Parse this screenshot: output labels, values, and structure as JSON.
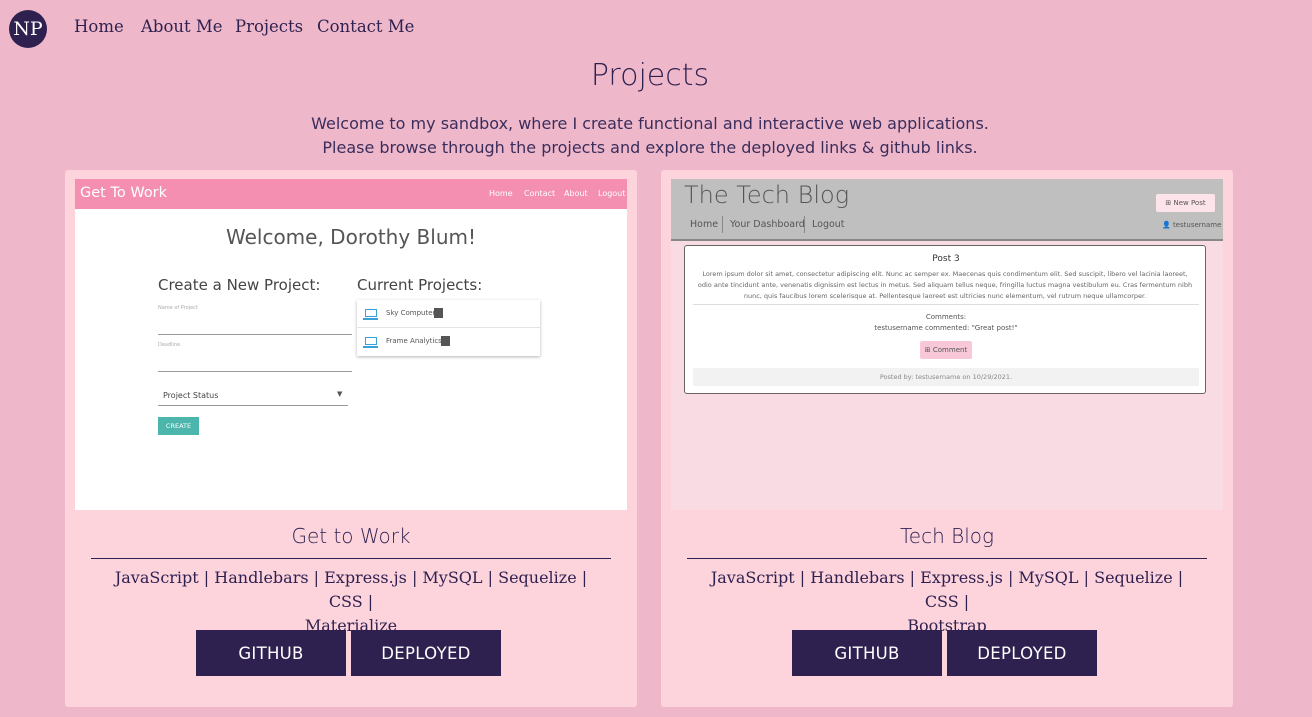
{
  "nav": {
    "logo": "NP",
    "links": [
      "Home",
      "About Me",
      "Projects",
      "Contact Me"
    ]
  },
  "page": {
    "title": "Projects",
    "intro_line1": "Welcome to my sandbox, where I create functional and interactive web applications.",
    "intro_line2": "Please browse through the projects and explore the deployed links & github links."
  },
  "projects": [
    {
      "title": "Get to Work",
      "tech_line1": "JavaScript | Handlebars | Express.js | MySQL | Sequelize | CSS |",
      "tech_line2": "Materialize",
      "github_label": "GITHUB",
      "deployed_label": "DEPLOYED",
      "preview": {
        "brand": "Get To Work",
        "nav": [
          "Home",
          "Contact",
          "About",
          "Logout"
        ],
        "welcome": "Welcome, Dorothy Blum!",
        "create_heading": "Create a New Project:",
        "current_heading": "Current Projects:",
        "name_label": "Name of Project",
        "deadline_label": "Deadline",
        "status_select": "Project Status",
        "create_button": "CREATE",
        "items": [
          "Sky Computer",
          "Frame Analytics"
        ]
      }
    },
    {
      "title": "Tech Blog",
      "tech_line1": "JavaScript | Handlebars | Express.js | MySQL | Sequelize | CSS |",
      "tech_line2": "Bootstrap",
      "github_label": "GITHUB",
      "deployed_label": "DEPLOYED",
      "preview": {
        "brand": "The Tech Blog",
        "new_post": "⊞ New Post",
        "nav": [
          "Home",
          "Your Dashboard",
          "Logout"
        ],
        "user": "👤 testusername",
        "post_title": "Post 3",
        "post_body": "Lorem ipsum dolor sit amet, consectetur adipiscing elit. Nunc ac semper ex. Maecenas quis condimentum elit. Sed suscipit, libero vel lacinia laoreet, odio ante tincidunt ante, venenatis dignissim est lectus in metus. Sed aliquam tellus neque, fringilla luctus magna vestibulum eu. Cras fermentum nibh nunc, quis faucibus lorem scelerisque at. Pellentesque laoreet est ultricies nunc elementum, vel rutrum neque ullamcorper.",
        "comments_label": "Comments:",
        "comment": "testusername commented: \"Great post!\"",
        "comment_button": "⊞ Comment",
        "footer": "Posted by: testusername on 10/29/2021."
      }
    }
  ]
}
